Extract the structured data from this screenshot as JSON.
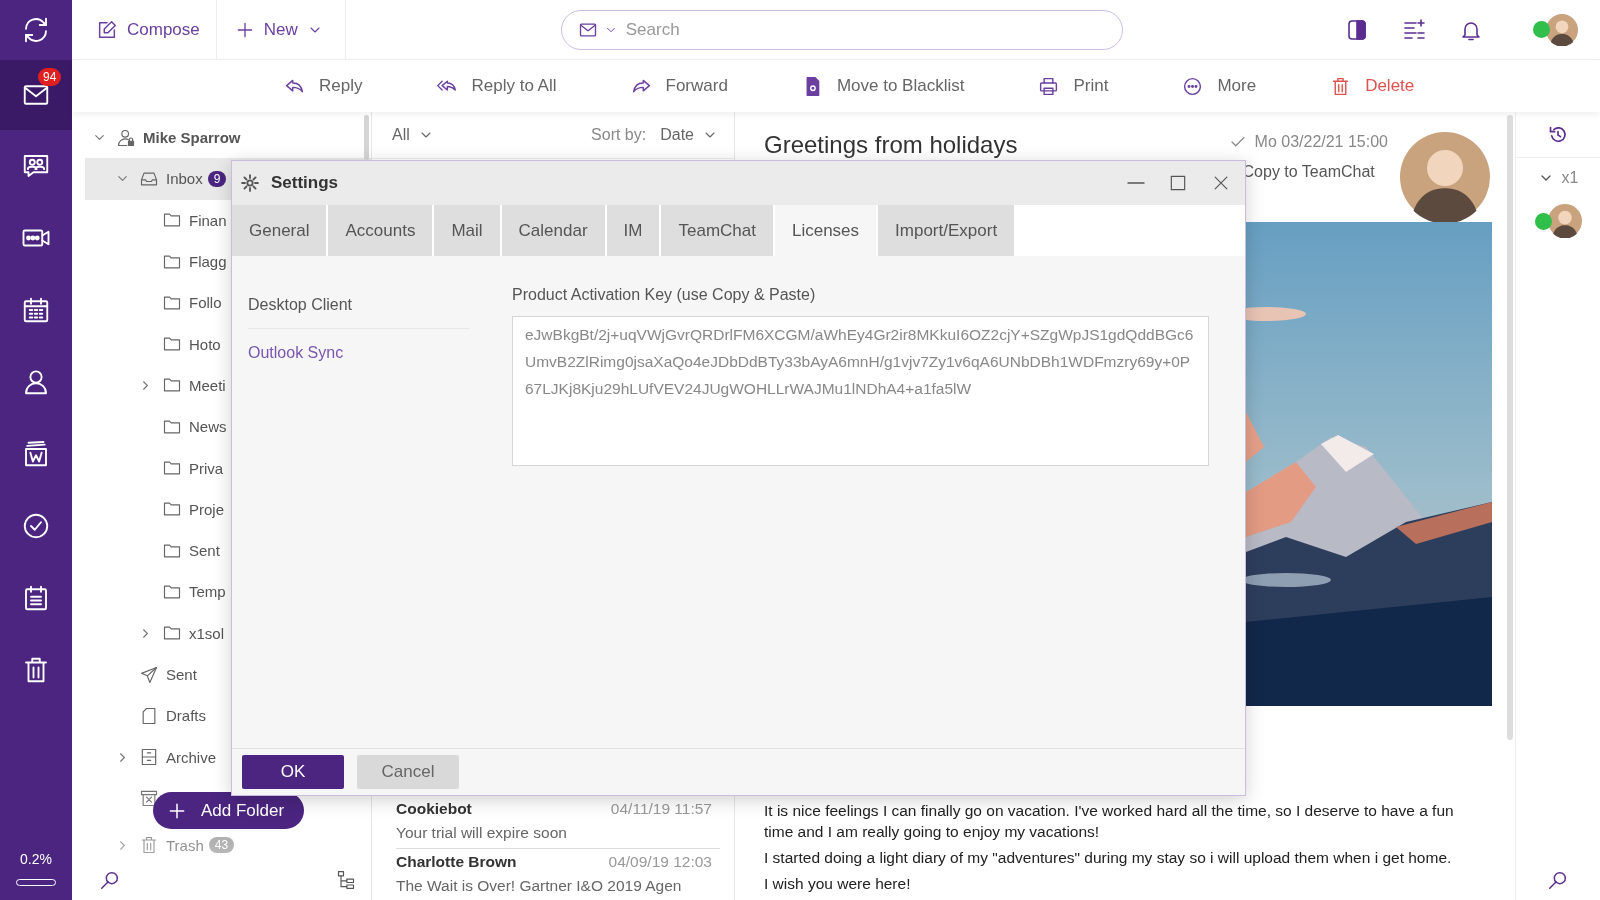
{
  "rail": {
    "items": [
      {
        "kind": "sync",
        "selected": false
      },
      {
        "kind": "mail",
        "selected": true,
        "badge": "94"
      },
      {
        "kind": "chat",
        "selected": false
      },
      {
        "kind": "video",
        "selected": false
      },
      {
        "kind": "calendar",
        "selected": false
      },
      {
        "kind": "contacts",
        "selected": false
      },
      {
        "kind": "documents",
        "selected": false
      },
      {
        "kind": "tasks",
        "selected": false
      },
      {
        "kind": "notes",
        "selected": false
      },
      {
        "kind": "trash",
        "selected": false
      }
    ],
    "storage": {
      "text": "0.2%",
      "level": 0.002
    }
  },
  "topbar": {
    "compose": "Compose",
    "new": "New",
    "search": {
      "placeholder": "Search"
    },
    "user": {
      "online": true
    }
  },
  "toolbar": [
    {
      "kind": "reply",
      "label": "Reply"
    },
    {
      "kind": "reply_all",
      "label": "Reply to All"
    },
    {
      "kind": "forward",
      "label": "Forward"
    },
    {
      "kind": "blacklist",
      "label": "Move to Blacklist"
    },
    {
      "kind": "print",
      "label": "Print"
    },
    {
      "kind": "more",
      "label": "More"
    },
    {
      "kind": "delete",
      "label": "Delete"
    }
  ],
  "folders": {
    "account": {
      "label": "Mike Sparrow",
      "expanded": true,
      "selected": false,
      "children": [
        {
          "kind": "inbox",
          "label": "Inbox",
          "badge": "9",
          "selected": true,
          "expanded": true,
          "children": [
            {
              "kind": "folder",
              "label": "Finan",
              "selected": false
            },
            {
              "kind": "folder",
              "label": "Flagg",
              "selected": false
            },
            {
              "kind": "folder",
              "label": "Follo",
              "selected": false
            },
            {
              "kind": "folder",
              "label": "Hoto",
              "selected": false
            },
            {
              "kind": "folder",
              "label": "Meeti",
              "selected": false,
              "expanded": false
            },
            {
              "kind": "folder",
              "label": "News",
              "selected": false
            },
            {
              "kind": "folder",
              "label": "Priva",
              "selected": false
            },
            {
              "kind": "folder",
              "label": "Proje",
              "selected": false
            },
            {
              "kind": "folder",
              "label": "Sent",
              "selected": false
            },
            {
              "kind": "folder",
              "label": "Temp",
              "selected": false
            },
            {
              "kind": "folder",
              "label": "x1sol",
              "selected": false,
              "expanded": false
            }
          ]
        },
        {
          "kind": "sent",
          "label": "Sent",
          "selected": false
        },
        {
          "kind": "drafts",
          "label": "Drafts",
          "selected": false
        },
        {
          "kind": "archive",
          "label": "Archive",
          "selected": false,
          "expanded": false
        },
        {
          "kind": "junk",
          "selected": false
        },
        {
          "kind": "trash",
          "label": "Trash",
          "badge": "43",
          "selected": false,
          "expanded": false
        }
      ]
    },
    "add_button": "Add Folder"
  },
  "message_list": {
    "filter": "All",
    "sort_label": "Sort by:",
    "sort": "Date",
    "messages": [
      {
        "sender": "Cookiebot",
        "date": "04/11/19 11:57",
        "preview": "Your trial will expire soon"
      },
      {
        "sender": "Charlotte Brown",
        "date": "04/09/19 12:03",
        "preview": "The Wait is Over! Gartner I&O 2019 Agen"
      }
    ]
  },
  "reading_pane": {
    "subject": "Greetings from holidays",
    "date": "Mo 03/22/21 15:00",
    "copy_action": "Copy to TeamChat",
    "body": [
      "It is nice feelings I can finally go on vacation. I've worked hard all the time, so I deserve to have a fun time and I am really going to enjoy my vacations!",
      "I started doing a light diary of my \"adventures\" during my stay so i will upload them when i get home.",
      "I wish you were here!"
    ]
  },
  "right_rail": {
    "count": "x1",
    "expanded": true,
    "contact": {
      "online": true
    }
  },
  "dialog": {
    "title": "Settings",
    "tabs": [
      {
        "label": "General",
        "selected": false
      },
      {
        "label": "Accounts",
        "selected": false
      },
      {
        "label": "Mail",
        "selected": false
      },
      {
        "label": "Calendar",
        "selected": false
      },
      {
        "label": "IM",
        "selected": false
      },
      {
        "label": "TeamChat",
        "selected": false
      },
      {
        "label": "Licenses",
        "selected": true
      },
      {
        "label": "Import/Export",
        "selected": false
      }
    ],
    "nav": [
      {
        "label": "Desktop Client",
        "selected": false
      },
      {
        "label": "Outlook Sync",
        "selected": true
      }
    ],
    "field": {
      "label": "Product Activation Key (use Copy & Paste)",
      "value": "eJwBkgBt/2j+uqVWjGvrQRDrlFM6XCGM/aWhEy4Gr2ir8MKkuI6OZ2cjY+SZgWpJS1gdQddBGc6UmvB2ZlRimg0jsaXaQo4eJDbDdBTy33bAyA6mnH/g1vjv7Zy1v6qA6UNbDBh1WDFmzry69y+0P67LJKj8Kju29hLUfVEV24JUgWOHLLrWAJMu1lNDhA4+a1fa5lW"
    },
    "buttons": [
      {
        "label": "OK",
        "kind": "primary"
      },
      {
        "label": "Cancel",
        "kind": "secondary"
      }
    ]
  }
}
